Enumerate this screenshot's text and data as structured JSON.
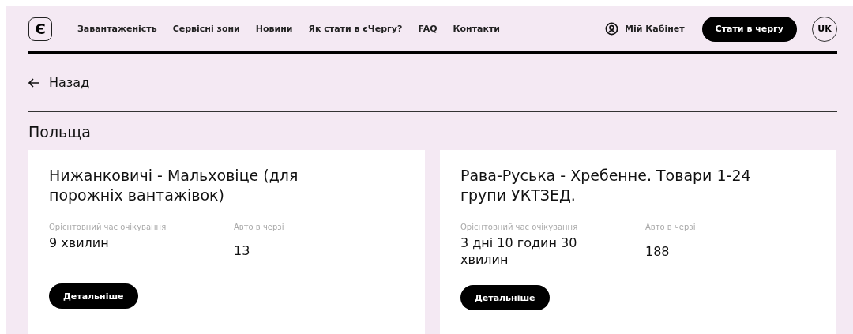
{
  "nav": {
    "logo": "Є",
    "links": [
      "Завантаженість",
      "Сервісні зони",
      "Новини",
      "Як стати в єЧергу?",
      "FAQ",
      "Контакти"
    ],
    "cabinet": "Мій Кабінет",
    "cta": "Стати в чергу",
    "language": "UK"
  },
  "back": "Назад",
  "section_title": "Польща",
  "cards": [
    {
      "title": "Нижанковичі - Мальховіце (для порожніх вантажівок)",
      "wait_label": "Орієнтовний час очікування",
      "wait": "9 хвилин",
      "queue_label": "Авто в черзі",
      "queue": "13",
      "button": "Детальніше"
    },
    {
      "title": "Рава-Руська - Хребенне. Товари 1-24 групи УКТЗЕД.",
      "wait_label": "Орієнтовний час очікування",
      "wait": "3 дні 10 годин 30 хвилин",
      "queue_label": "Авто в черзі",
      "queue": "188",
      "button": "Детальніше"
    }
  ]
}
